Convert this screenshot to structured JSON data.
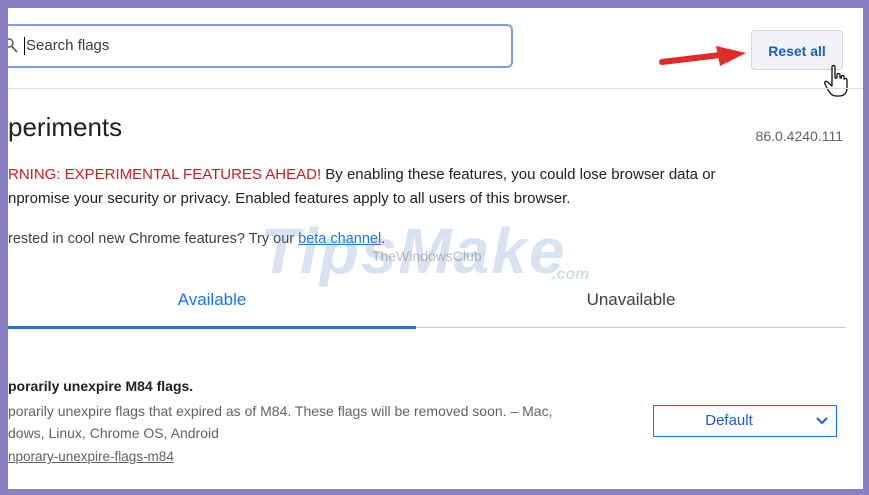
{
  "search": {
    "placeholder": "Search flags"
  },
  "toolbar": {
    "reset_label": "Reset all"
  },
  "page": {
    "title": "periments",
    "version": "86.0.4240.111",
    "warning_red": "RNING: EXPERIMENTAL FEATURES AHEAD!",
    "warning_text_line1": " By enabling these features, you could lose browser data or",
    "warning_text_line2": "npromise your security or privacy. Enabled features apply to all users of this browser.",
    "interest_text": "rested in cool new Chrome features? Try our ",
    "interest_link": "beta channel",
    "interest_end": "."
  },
  "watermark": {
    "brand": "TipsMake",
    "com": ".com",
    "small": "TheWindowsClub"
  },
  "tabs": [
    {
      "label": "Available",
      "active": true
    },
    {
      "label": "Unavailable",
      "active": false
    }
  ],
  "flag": {
    "title": "porarily unexpire M84 flags.",
    "description_line1": "porarily unexpire flags that expired as of M84. These flags will be removed soon. – Mac,",
    "description_line2": "dows, Linux, Chrome OS, Android",
    "link": "nporary-unexpire-flags-m84",
    "select_value": "Default"
  },
  "icons": [
    "search-icon",
    "red-arrow-icon",
    "hand-cursor-icon",
    "chevron-down-icon"
  ],
  "colors": {
    "frame": "#8d7fc4",
    "accent": "#1a73e8",
    "warning": "#c5221f"
  }
}
